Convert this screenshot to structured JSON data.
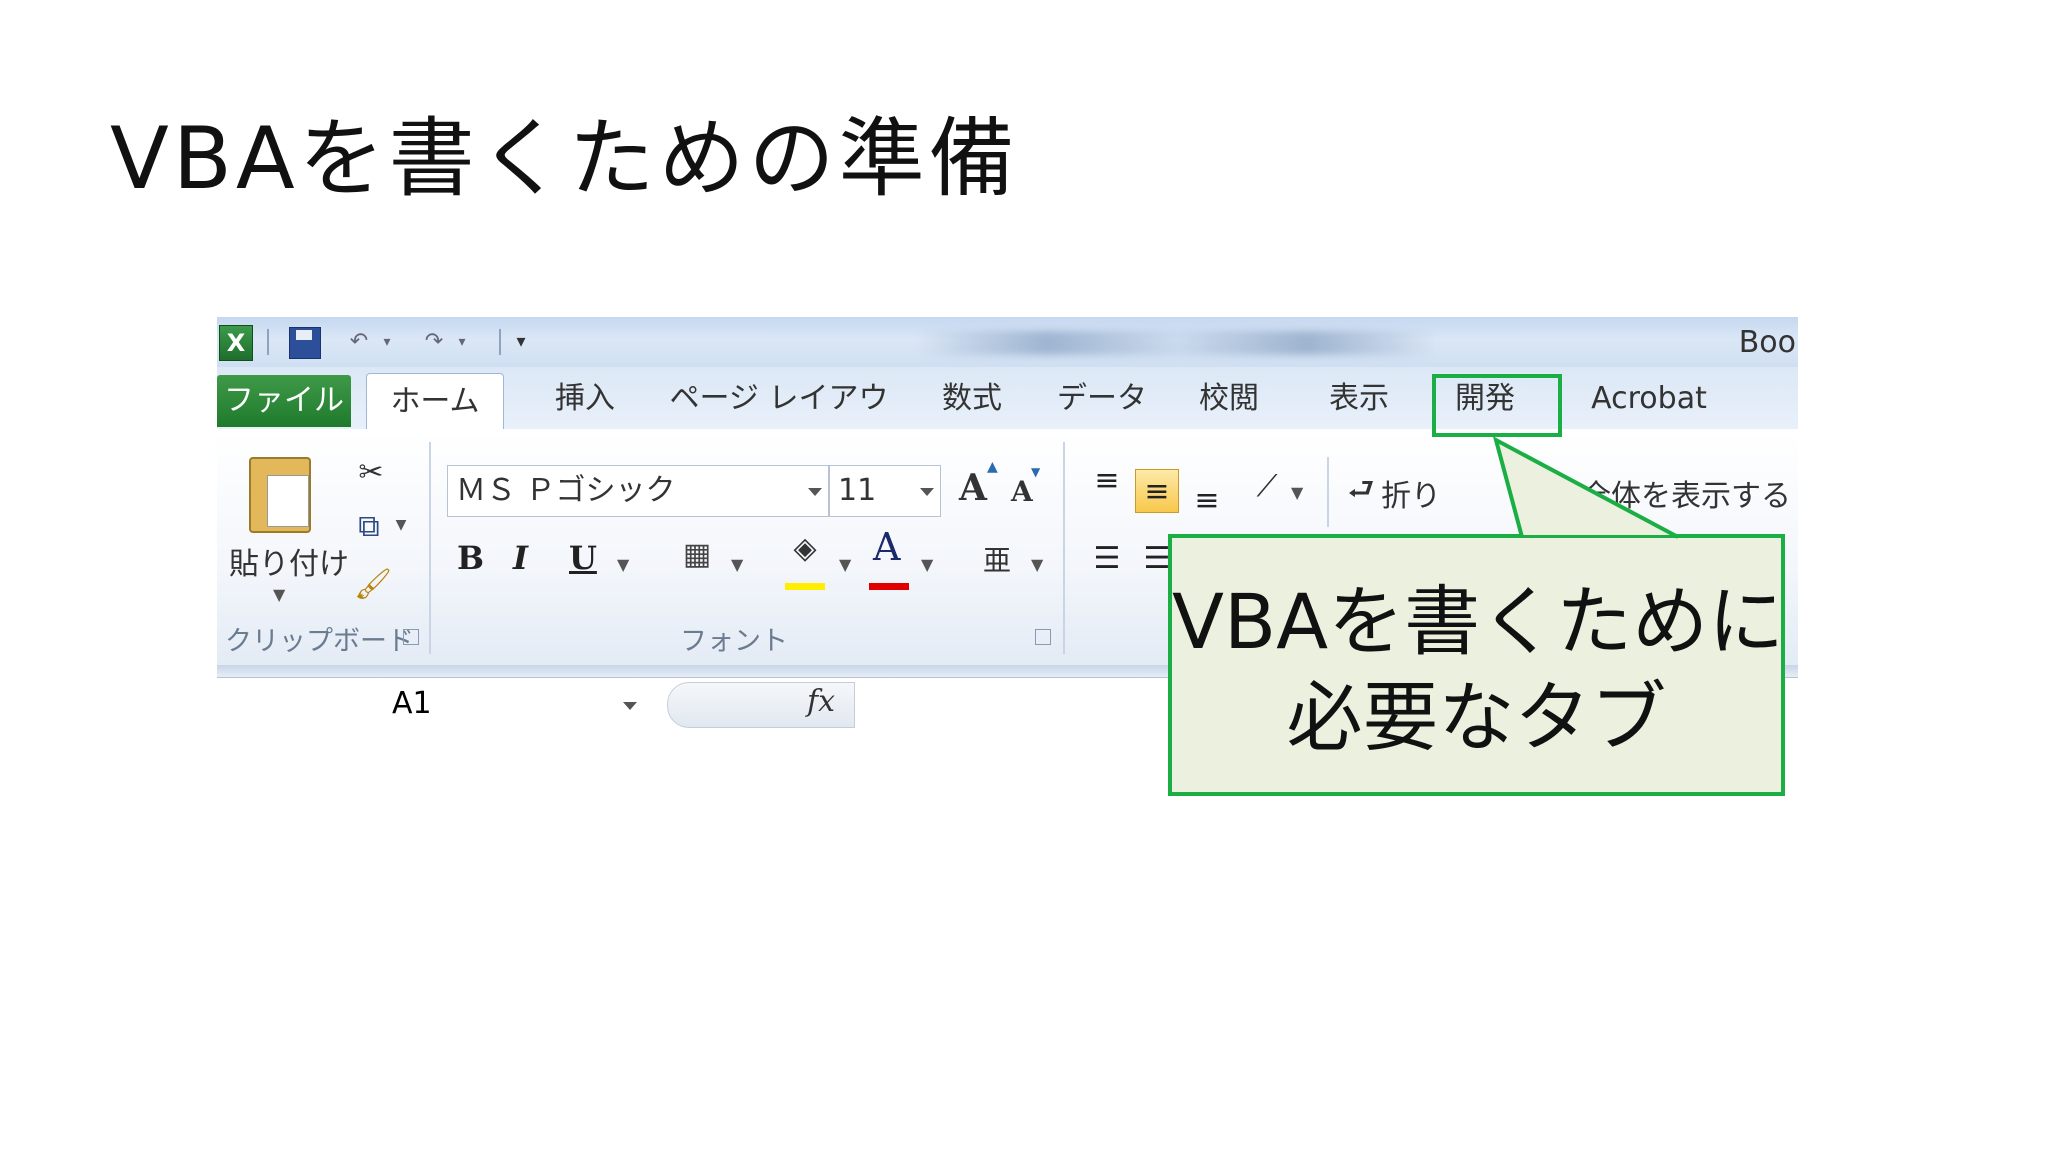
{
  "slide": {
    "title": "VBAを書くための準備"
  },
  "excel": {
    "qat": {
      "logo": "X",
      "book_title": "Boo"
    },
    "tabs": [
      {
        "label": "ファイル"
      },
      {
        "label": "ホーム"
      },
      {
        "label": "挿入"
      },
      {
        "label": "ページ レイアウト"
      },
      {
        "label": "数式"
      },
      {
        "label": "データ"
      },
      {
        "label": "校閲"
      },
      {
        "label": "表示"
      },
      {
        "label": "開発"
      },
      {
        "label": "Acrobat"
      }
    ],
    "ribbon": {
      "clipboard": {
        "paste_label": "貼り付け",
        "group_label": "クリップボード"
      },
      "font": {
        "font_name": "ＭＳ Ｐゴシック",
        "font_size": "11",
        "grow_label": "A",
        "shrink_label": "A",
        "bold": "B",
        "italic": "I",
        "underline": "U",
        "font_color_glyph": "A",
        "phonetic_glyph": "亜",
        "group_label": "フォント",
        "fill_color": "#ffee00",
        "font_color": "#e00000"
      },
      "alignment": {
        "wrap_label": "折り",
        "merge_label": "全体を表示する"
      }
    },
    "formula_bar": {
      "name_box": "A1",
      "fx_label": "fx"
    }
  },
  "callout": {
    "line1": "VBAを書くために",
    "line2": "必要なタブ",
    "border_color": "#1aae44",
    "fill_color": "#ebf1de"
  }
}
